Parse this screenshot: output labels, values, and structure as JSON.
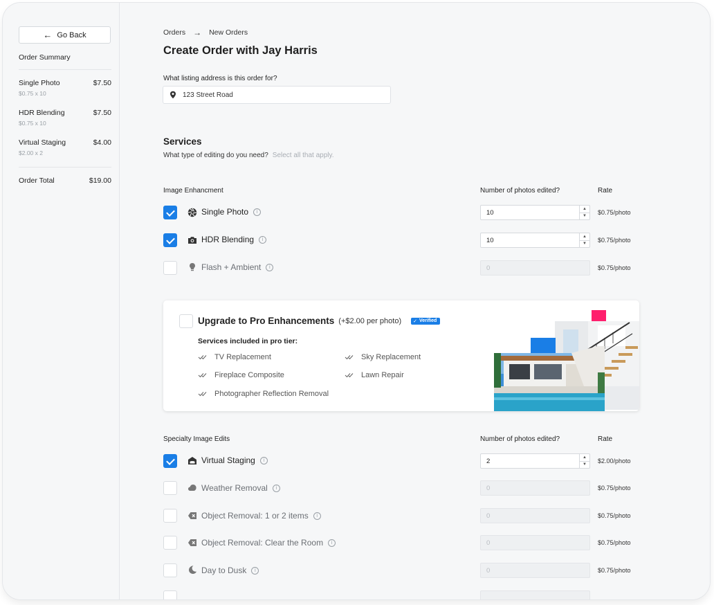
{
  "sidebar": {
    "back_label": "Go Back",
    "summary_title": "Order Summary",
    "items": [
      {
        "name": "Single Photo",
        "price": "$7.50",
        "detail": "$0.75 x 10"
      },
      {
        "name": "HDR Blending",
        "price": "$7.50",
        "detail": "$0.75 x 10"
      },
      {
        "name": "Virtual Staging",
        "price": "$4.00",
        "detail": "$2.00 x 2"
      }
    ],
    "total_label": "Order Total",
    "total_value": "$19.00"
  },
  "breadcrumb": {
    "parent": "Orders",
    "current": "New Orders"
  },
  "page_title": "Create Order with Jay Harris",
  "address": {
    "label": "What listing address is this order for?",
    "value": "123 Street Road"
  },
  "services": {
    "heading": "Services",
    "question": "What type of editing do you need?",
    "hint": "Select all that apply."
  },
  "image_enhancement": {
    "heading": "Image Enhancment",
    "count_heading": "Number of photos edited?",
    "rate_heading": "Rate",
    "items": [
      {
        "label": "Single Photo",
        "icon": "aperture-icon",
        "checked": true,
        "count": "10",
        "rate": "$0.75/photo"
      },
      {
        "label": "HDR Blending",
        "icon": "camera-icon",
        "checked": true,
        "count": "10",
        "rate": "$0.75/photo"
      },
      {
        "label": "Flash + Ambient",
        "icon": "lightbulb-icon",
        "checked": false,
        "count": "0",
        "rate": "$0.75/photo"
      }
    ]
  },
  "pro": {
    "title": "Upgrade to Pro Enhancements",
    "price": "(+$2.00 per photo)",
    "badge": "Verified",
    "subheading": "Services included in pro tier:",
    "features": [
      "TV Replacement",
      "Sky Replacement",
      "Fireplace Composite",
      "Lawn Repair",
      "Photographer Reflection Removal"
    ],
    "colors": {
      "accent_blue": "#1a7ee6",
      "accent_pink": "#ff1f6d"
    }
  },
  "specialty": {
    "heading": "Specialty Image Edits",
    "count_heading": "Number of photos edited?",
    "rate_heading": "Rate",
    "items": [
      {
        "label": "Virtual Staging",
        "icon": "sofa-icon",
        "checked": true,
        "count": "2",
        "rate": "$2.00/photo"
      },
      {
        "label": "Weather Removal",
        "icon": "cloud-icon",
        "checked": false,
        "count": "0",
        "rate": "$0.75/photo"
      },
      {
        "label": "Object Removal: 1 or 2 items",
        "icon": "erase-icon",
        "checked": false,
        "count": "0",
        "rate": "$0.75/photo"
      },
      {
        "label": "Object Removal: Clear the Room",
        "icon": "erase-icon",
        "checked": false,
        "count": "0",
        "rate": "$0.75/photo"
      },
      {
        "label": "Day to Dusk",
        "icon": "moon-icon",
        "checked": false,
        "count": "0",
        "rate": "$0.75/photo"
      }
    ]
  }
}
